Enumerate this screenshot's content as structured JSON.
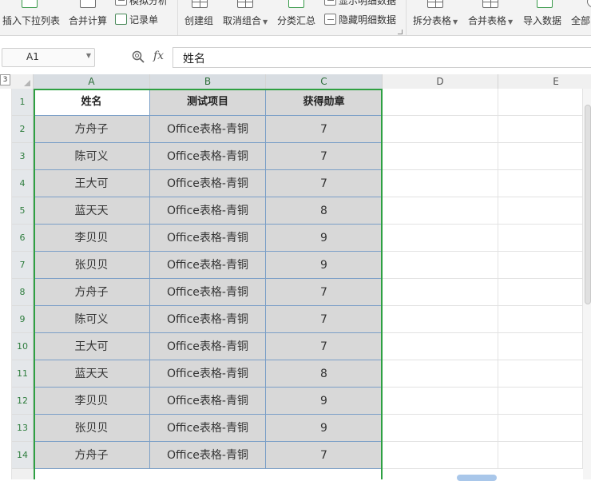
{
  "ribbon": {
    "insert_dropdown": "插入下拉列表",
    "merge_calc": "合并计算",
    "record_form": "记录单",
    "sim_analysis": "模拟分析",
    "create_group": "创建组",
    "ungroup": "取消组合",
    "subtotal": "分类汇总",
    "show_detail": "显示明细数据",
    "hide_detail": "隐藏明细数据",
    "split_table": "拆分表格",
    "merge_table": "合并表格",
    "import_data": "导入数据",
    "all": "全部"
  },
  "formula_bar": {
    "name_box": "A1",
    "fx_label": "fx",
    "content": "姓名"
  },
  "sheet": {
    "outline_level": "3",
    "columns": [
      "A",
      "B",
      "C",
      "D",
      "E"
    ],
    "rows": [
      {
        "num": "1",
        "a": "姓名",
        "b": "测试项目",
        "c": "获得勋章"
      },
      {
        "num": "2",
        "a": "方舟子",
        "b": "Office表格-青铜",
        "c": "7"
      },
      {
        "num": "3",
        "a": "陈可义",
        "b": "Office表格-青铜",
        "c": "7"
      },
      {
        "num": "4",
        "a": "王大可",
        "b": "Office表格-青铜",
        "c": "7"
      },
      {
        "num": "5",
        "a": "蓝天天",
        "b": "Office表格-青铜",
        "c": "8"
      },
      {
        "num": "6",
        "a": "李贝贝",
        "b": "Office表格-青铜",
        "c": "9"
      },
      {
        "num": "7",
        "a": "张贝贝",
        "b": "Office表格-青铜",
        "c": "9"
      },
      {
        "num": "8",
        "a": "方舟子",
        "b": "Office表格-青铜",
        "c": "7"
      },
      {
        "num": "9",
        "a": "陈可义",
        "b": "Office表格-青铜",
        "c": "7"
      },
      {
        "num": "10",
        "a": "王大可",
        "b": "Office表格-青铜",
        "c": "7"
      },
      {
        "num": "11",
        "a": "蓝天天",
        "b": "Office表格-青铜",
        "c": "8"
      },
      {
        "num": "12",
        "a": "李贝贝",
        "b": "Office表格-青铜",
        "c": "9"
      },
      {
        "num": "13",
        "a": "张贝贝",
        "b": "Office表格-青铜",
        "c": "9"
      },
      {
        "num": "14",
        "a": "方舟子",
        "b": "Office表格-青铜",
        "c": "7"
      }
    ]
  },
  "colors": {
    "selection_border": "#2ea043",
    "selected_fill": "#d8d8d8",
    "cell_border": "#7b9fc7",
    "row_number": "#2e7d3e"
  }
}
